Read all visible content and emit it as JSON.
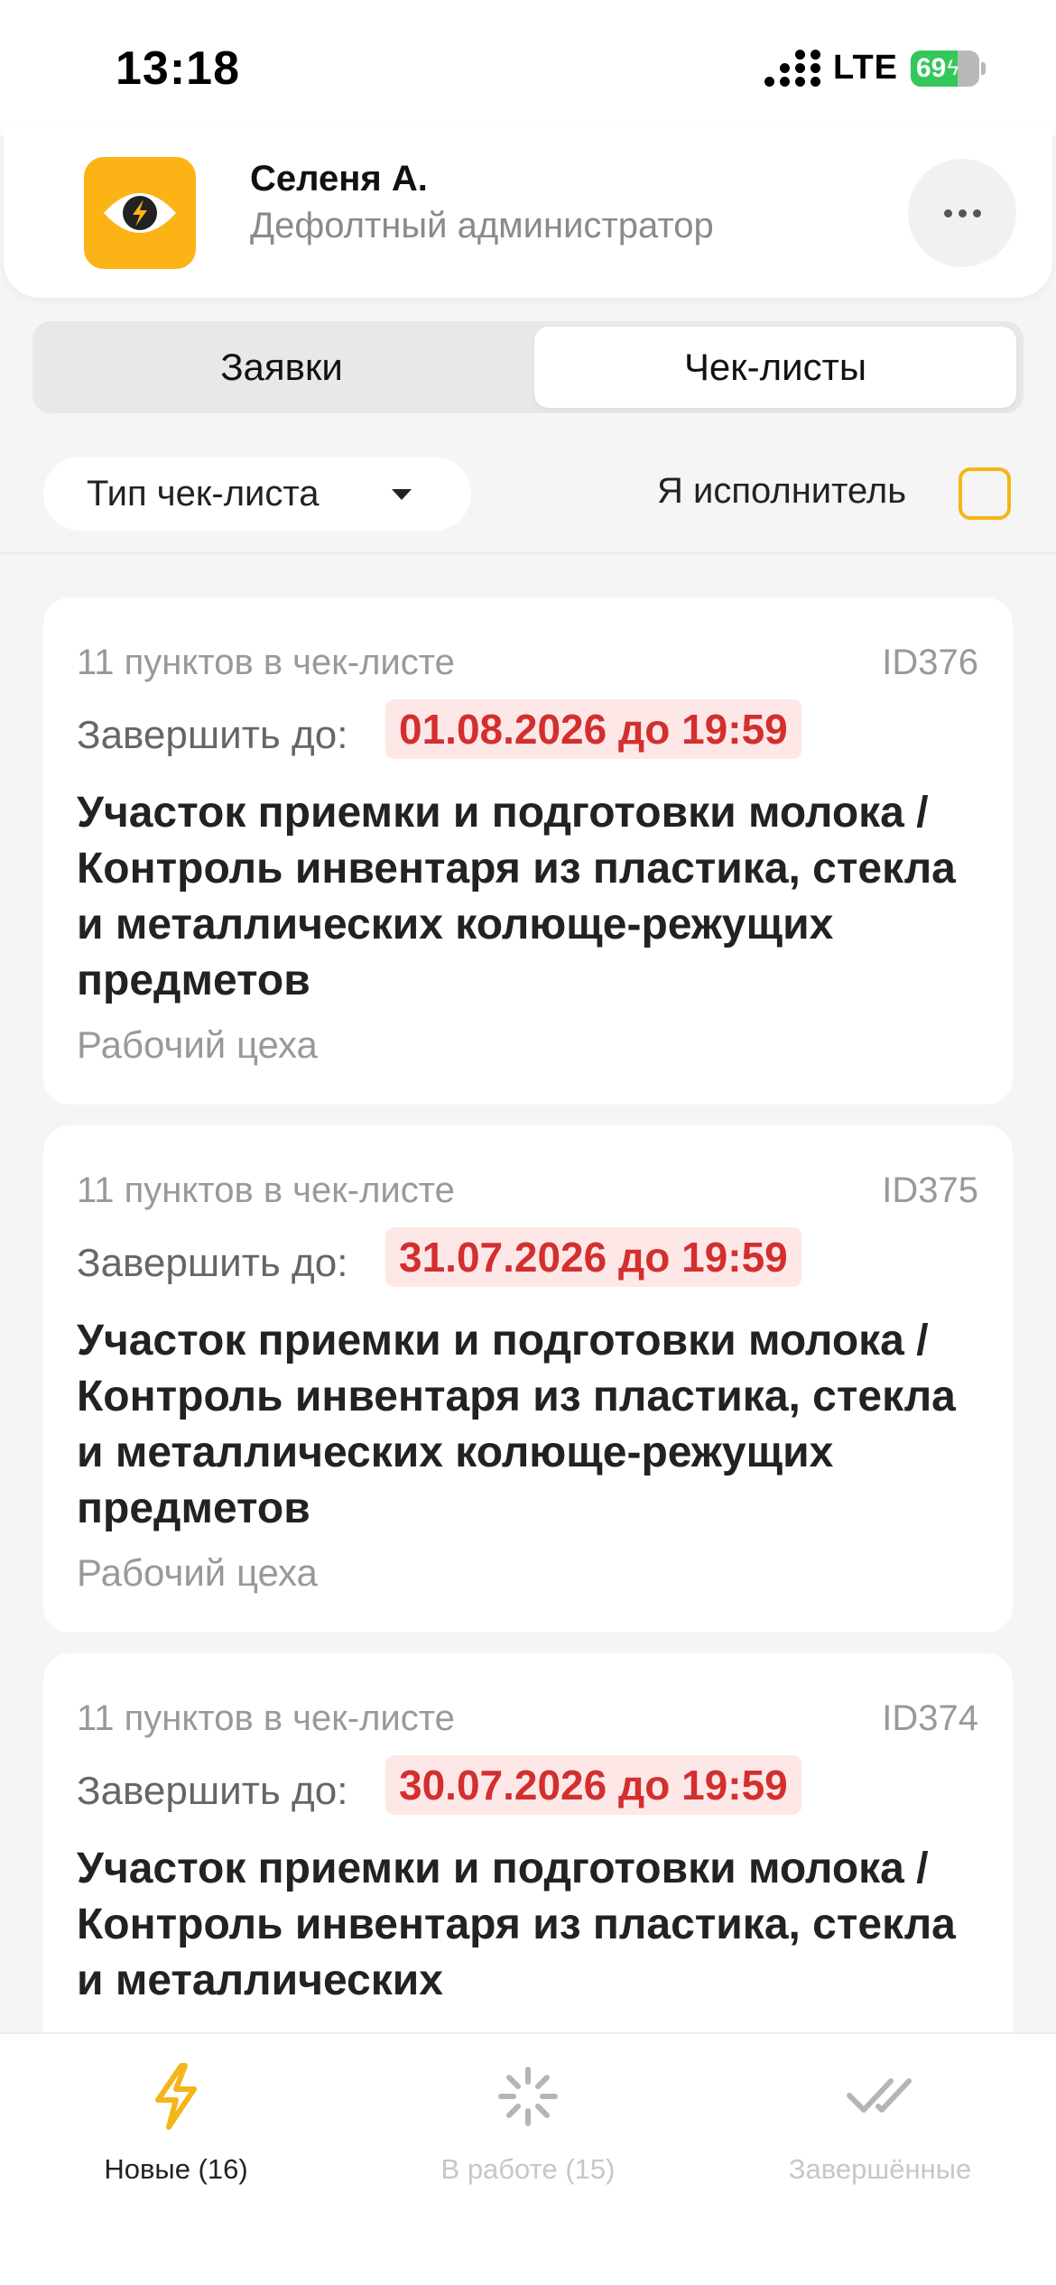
{
  "status_bar": {
    "time": "13:18",
    "network": "LTE",
    "battery": 69
  },
  "header": {
    "user_name": "Селеня А.",
    "user_role": "Дефолтный администратор",
    "logo_icon": "eye-lightning-icon",
    "more_icon": "more-dots-icon",
    "brand_color": "#FBB315"
  },
  "tabs": [
    {
      "label": "Заявки",
      "selected": false
    },
    {
      "label": "Чек-листы",
      "selected": true
    }
  ],
  "filters": {
    "type_label": "Тип чек-листа",
    "executor_label": "Я исполнитель",
    "executor_checked": false
  },
  "cards": [
    {
      "count": "11 пунктов в чек-листе",
      "id": "ID376",
      "deadline_label": "Завершить до:",
      "deadline": "01.08.2026 до 19:59",
      "title": "Участок приемки и подготовки молока / Контроль инвентаря из пластика, стекла и металлических колюще-режущих предметов",
      "subtitle": "Рабочий цеха"
    },
    {
      "count": "11 пунктов в чек-листе",
      "id": "ID375",
      "deadline_label": "Завершить до:",
      "deadline": "31.07.2026 до 19:59",
      "title": "Участок приемки и подготовки молока / Контроль инвентаря из пластика, стекла и металлических колюще-режущих предметов",
      "subtitle": "Рабочий цеха"
    },
    {
      "count": "11 пунктов в чек-листе",
      "id": "ID374",
      "deadline_label": "Завершить до:",
      "deadline": "30.07.2026 до 19:59",
      "title": "Участок приемки и подготовки молока / Контроль инвентаря из пластика, стекла и металлических",
      "subtitle": ""
    }
  ],
  "bottom_nav": [
    {
      "label": "Новые (16)",
      "icon": "lightning-icon",
      "active": true
    },
    {
      "label": "В работе (15)",
      "icon": "spinner-icon",
      "active": false
    },
    {
      "label": "Завершённые",
      "icon": "double-check-icon",
      "active": false
    }
  ],
  "colors": {
    "accent": "#F5B418",
    "deadline_text": "#D32F2F",
    "deadline_bg": "#FDE7E7",
    "inactive_nav": "#C7C7C7"
  }
}
